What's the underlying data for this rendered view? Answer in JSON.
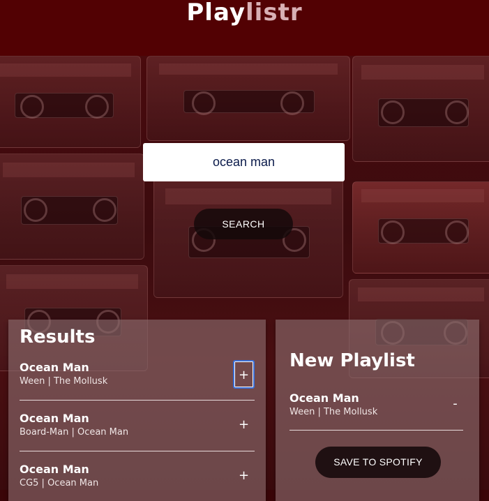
{
  "app": {
    "logo_main": "Play",
    "logo_accent": "listr"
  },
  "search": {
    "value": "ocean man",
    "button_label": "SEARCH"
  },
  "results": {
    "title": "Results",
    "tracks": [
      {
        "name": "Ocean Man",
        "info": "Ween | The Mollusk",
        "action": "+"
      },
      {
        "name": "Ocean Man",
        "info": "Board-Man | Ocean Man",
        "action": "+"
      },
      {
        "name": "Ocean Man",
        "info": "CG5 | Ocean Man",
        "action": "+"
      }
    ]
  },
  "playlist": {
    "title": "New Playlist",
    "tracks": [
      {
        "name": "Ocean Man",
        "info": "Ween | The Mollusk",
        "action": "-"
      }
    ],
    "save_label": "SAVE TO SPOTIFY"
  }
}
